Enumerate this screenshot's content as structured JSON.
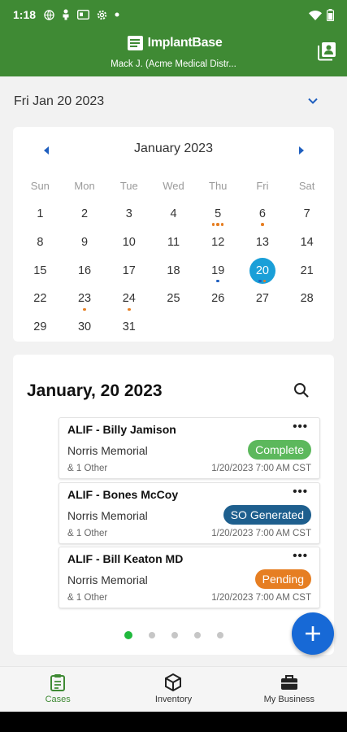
{
  "status_bar": {
    "time": "1:18",
    "icons": [
      "globe-icon",
      "person-icon",
      "card-icon",
      "gear-icon",
      "dot-icon",
      "wifi-icon",
      "battery-icon"
    ]
  },
  "app_bar": {
    "brand": "ImplantBase",
    "account": "Mack J. (Acme Medical Distr...",
    "background_color": "#3f8a34"
  },
  "date_selector": {
    "value": "Fri Jan 20 2023"
  },
  "calendar": {
    "month_label": "January 2023",
    "weekdays": [
      "Sun",
      "Mon",
      "Tue",
      "Wed",
      "Thu",
      "Fri",
      "Sat"
    ],
    "weeks": [
      [
        "1",
        "2",
        "3",
        "4",
        "5",
        "6",
        "7"
      ],
      [
        "8",
        "9",
        "10",
        "11",
        "12",
        "13",
        "14"
      ],
      [
        "15",
        "16",
        "17",
        "18",
        "19",
        "20",
        "21"
      ],
      [
        "22",
        "23",
        "24",
        "25",
        "26",
        "27",
        "28"
      ],
      [
        "29",
        "30",
        "31",
        "",
        "",
        "",
        ""
      ]
    ],
    "selected_day": "20",
    "event_dots": {
      "5": [
        "orange",
        "orange",
        "orange"
      ],
      "6": [
        "orange"
      ],
      "19": [
        "blue"
      ],
      "20": [
        "blue",
        "orange"
      ],
      "23": [
        "orange"
      ],
      "24": [
        "orange"
      ]
    },
    "dot_colors": {
      "orange": "#e67e22",
      "blue": "#1f5fbf"
    },
    "today_color": "#1a9fd8"
  },
  "cases": {
    "title": "January, 20 2023",
    "items": [
      {
        "title": "ALIF - Billy Jamison",
        "location": "Norris Memorial",
        "status": "Complete",
        "status_color": "#5cb85c",
        "others": "& 1 Other",
        "time": "1/20/2023 7:00 AM CST"
      },
      {
        "title": "ALIF - Bones McCoy",
        "location": "Norris Memorial",
        "status": "SO Generated",
        "status_color": "#1e5f8e",
        "others": "& 1 Other",
        "time": "1/20/2023 7:00 AM CST"
      },
      {
        "title": "ALIF - Bill Keaton MD",
        "location": "Norris Memorial",
        "status": "Pending",
        "status_color": "#e67e22",
        "others": "& 1 Other",
        "time": "1/20/2023 7:00 AM CST"
      }
    ],
    "pager": {
      "pages": 5,
      "active": 0
    }
  },
  "bottom_nav": [
    {
      "label": "Cases",
      "icon": "clipboard-icon",
      "active": true
    },
    {
      "label": "Inventory",
      "icon": "box-icon",
      "active": false
    },
    {
      "label": "My Business",
      "icon": "briefcase-icon",
      "active": false
    }
  ]
}
